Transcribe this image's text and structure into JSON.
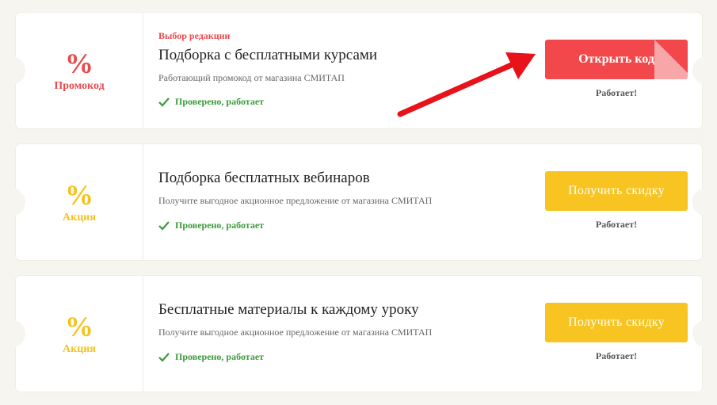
{
  "colors": {
    "accent_red": "#f2484b",
    "accent_yellow": "#f7c422",
    "verified_green": "#3a9b3a",
    "background": "#f6f5f0"
  },
  "offers": [
    {
      "icon": "percent-icon",
      "percent": "%",
      "type": "Промокод",
      "tag": "Выбор редакции",
      "title": "Подборка с бесплатными курсами",
      "description": "Работающий промокод от магазина СМИТАП",
      "verified": "Проверено, работает",
      "button": "Открыть код",
      "status": "Работает!"
    },
    {
      "icon": "percent-icon",
      "percent": "%",
      "type": "Акция",
      "title": "Подборка бесплатных вебинаров",
      "description": "Получите выгодное акционное предложение от магазина СМИТАП",
      "verified": "Проверено, работает",
      "button": "Получить скидку",
      "status": "Работает!"
    },
    {
      "icon": "percent-icon",
      "percent": "%",
      "type": "Акция",
      "title": "Бесплатные материалы к каждому уроку",
      "description": "Получите выгодное акционное предложение от магазина СМИТАП",
      "verified": "Проверено, работает",
      "button": "Получить скидку",
      "status": "Работает!"
    }
  ]
}
